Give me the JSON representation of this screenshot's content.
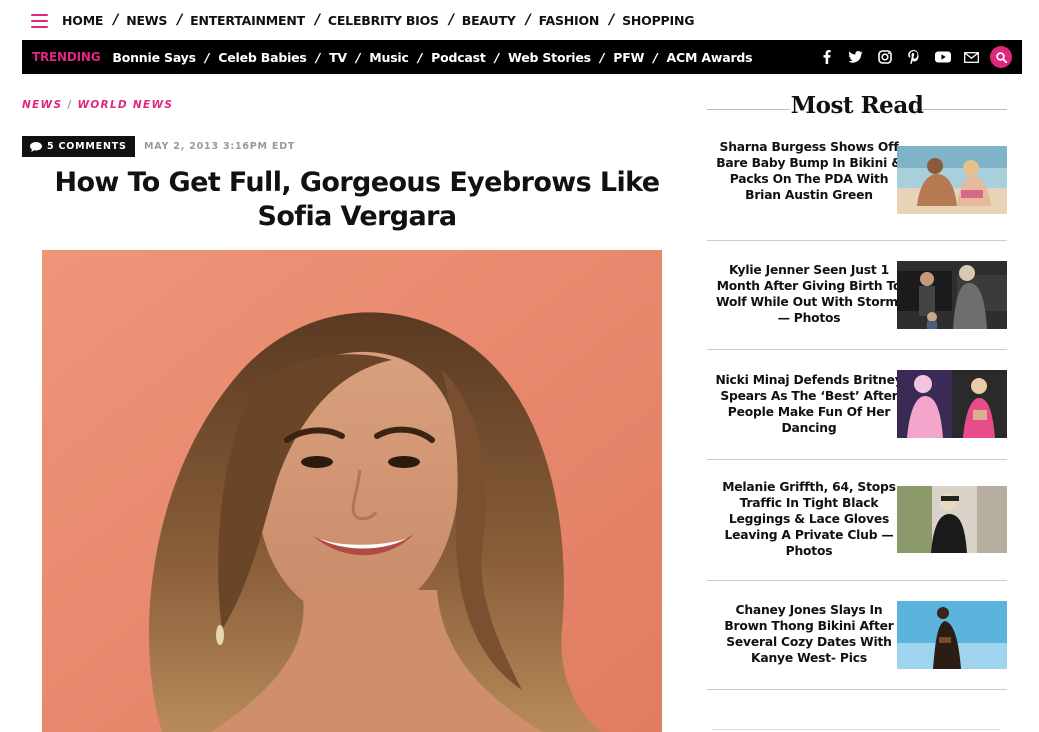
{
  "nav": {
    "menu_icon": "hamburger-icon",
    "items": [
      "HOME",
      "NEWS",
      "ENTERTAINMENT",
      "CELEBRITY BIOS",
      "BEAUTY",
      "FASHION",
      "SHOPPING"
    ],
    "separator": "/"
  },
  "trending": {
    "label": "TRENDING",
    "items": [
      "Bonnie Says",
      "Celeb Babies",
      "TV",
      "Music",
      "Podcast",
      "Web Stories",
      "PFW",
      "ACM Awards"
    ],
    "separator": "/",
    "social_icons": [
      "facebook-icon",
      "twitter-icon",
      "instagram-icon",
      "pinterest-icon",
      "youtube-icon",
      "email-icon"
    ],
    "search_icon": "search-icon"
  },
  "colors": {
    "accent": "#e0267f",
    "bar": "#000000",
    "text": "#111111",
    "meta": "#999999"
  },
  "breadcrumb": {
    "items": [
      "NEWS",
      "WORLD NEWS"
    ],
    "separator": "/"
  },
  "article": {
    "comments_label": "5 COMMENTS",
    "comment_icon": "comment-bubble-icon",
    "date": "MAY 2, 2013 3:16PM EDT",
    "headline": "How To Get Full, Gorgeous Eyebrows Like Sofia Vergara"
  },
  "sidebar": {
    "title": "Most Read",
    "items": [
      {
        "title": "Sharna Burgess Shows Off Bare Baby Bump In Bikini & Packs On The PDA With Brian Austin Green"
      },
      {
        "title": "Kylie Jenner Seen Just 1 Month After Giving Birth To Wolf While Out With Stormi — Photos"
      },
      {
        "title": "Nicki Minaj Defends Britney Spears As The ‘Best’ After People Make Fun Of Her Dancing"
      },
      {
        "title": "Melanie Griffth, 64, Stops Traffic In Tight Black Leggings & Lace Gloves Leaving A Private Club — Photos"
      },
      {
        "title": "Chaney Jones Slays In Brown Thong Bikini After Several Cozy Dates With Kanye West- Pics"
      }
    ]
  }
}
